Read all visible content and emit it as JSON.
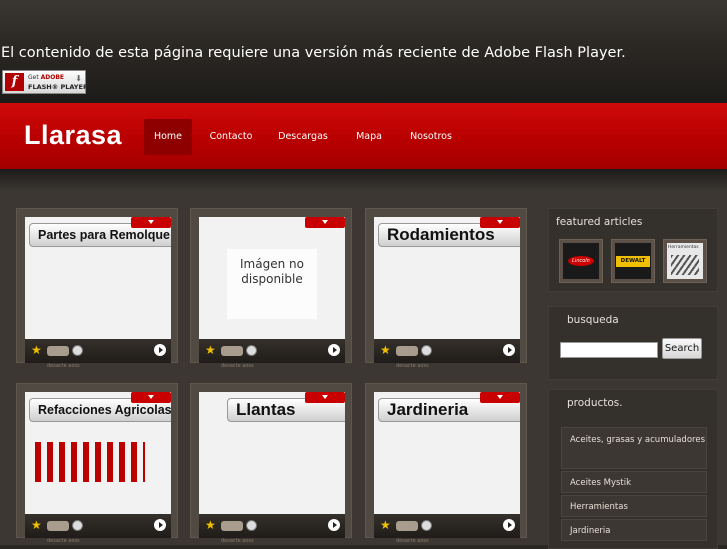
{
  "flash": {
    "message": "El contenido de esta página requiere una versión más reciente de Adobe Flash Player.",
    "badge_line1_prefix": "Get ",
    "badge_line1_brand": "ADOBE",
    "badge_line2": "FLASH® PLAYER"
  },
  "header": {
    "logo": "Llarasa",
    "nav": [
      {
        "label": "Home",
        "active": true
      },
      {
        "label": "Contacto"
      },
      {
        "label": "Descargas"
      },
      {
        "label": "Mapa"
      },
      {
        "label": "Nosotros"
      }
    ]
  },
  "products_grid": [
    {
      "title": "Partes para Remolque",
      "image": "trailer-parts"
    },
    {
      "title": "",
      "image": "no-image",
      "placeholder_text": "Imágen no disponible"
    },
    {
      "title": "Rodamientos",
      "image": "bearings"
    },
    {
      "title": "Refacciones Agricolas",
      "image": "agricultural-parts"
    },
    {
      "title": "Llantas",
      "image": "tires"
    },
    {
      "title": "Jardineria",
      "image": "garden-equipment"
    }
  ],
  "card_caption": "desacte aoss",
  "sidebar": {
    "featured_title": "featured articles",
    "featured_thumbs": [
      {
        "name": "lincoln-logo",
        "text": "Lincoln"
      },
      {
        "name": "dewalt-logo",
        "text": "DEWALT"
      },
      {
        "name": "herramientas-thumb",
        "text": "Herramientas"
      }
    ],
    "search_title": "busqueda",
    "search_value": "",
    "search_button": "Search",
    "products_title": "productos.",
    "products": [
      "Aceites, grasas y acumuladores",
      "Aceites Mystik",
      "Herramientas",
      "Jardineria"
    ]
  },
  "colors": {
    "brand_red": "#c00000",
    "background": "#3c3732"
  }
}
